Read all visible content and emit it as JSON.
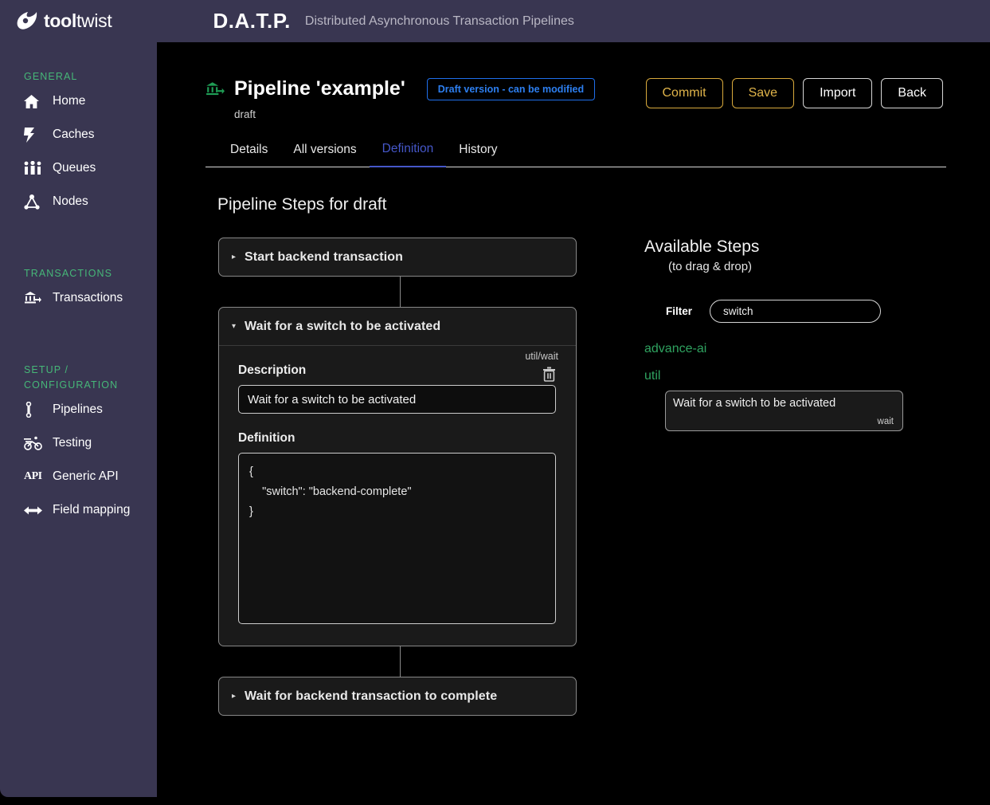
{
  "topbar": {
    "brand_bold": "tool",
    "brand_light": "twist",
    "logo_icon": "flame-logo-icon",
    "product": "D.A.T.P.",
    "product_subtitle": "Distributed Asynchronous Transaction Pipelines"
  },
  "sidebar": {
    "groups": [
      {
        "label": "GENERAL",
        "items": [
          {
            "label": "Home",
            "icon": "home-icon"
          },
          {
            "label": "Caches",
            "icon": "bolt-icon"
          },
          {
            "label": "Queues",
            "icon": "queue-people-icon"
          },
          {
            "label": "Nodes",
            "icon": "nodes-graph-icon"
          }
        ]
      },
      {
        "label": "TRANSACTIONS",
        "items": [
          {
            "label": "Transactions",
            "icon": "bank-transfer-icon"
          }
        ]
      },
      {
        "label": "SETUP / CONFIGURATION",
        "items": [
          {
            "label": "Pipelines",
            "icon": "pipeline-icon"
          },
          {
            "label": "Testing",
            "icon": "cyclist-icon"
          },
          {
            "label": "Generic API",
            "icon": "api-icon"
          },
          {
            "label": "Field mapping",
            "icon": "arrows-left-right-icon"
          }
        ]
      }
    ]
  },
  "header": {
    "icon": "bank-transfer-icon",
    "title": "Pipeline 'example'",
    "badge": "Draft version - can be modified",
    "subtitle": "draft",
    "badge_color": "#2d7ff0",
    "actions": [
      {
        "label": "Commit",
        "style": "amber"
      },
      {
        "label": "Save",
        "style": "amber"
      },
      {
        "label": "Import",
        "style": "plain"
      },
      {
        "label": "Back",
        "style": "plain"
      }
    ]
  },
  "tabs": [
    {
      "label": "Details",
      "active": false
    },
    {
      "label": "All versions",
      "active": false
    },
    {
      "label": "Definition",
      "active": true
    },
    {
      "label": "History",
      "active": false
    }
  ],
  "main": {
    "section_title": "Pipeline Steps for draft",
    "steps": [
      {
        "title": "Start backend transaction",
        "expanded": false,
        "caret": "▸"
      },
      {
        "title": "Wait for a switch to be activated",
        "expanded": true,
        "caret": "▾",
        "type": "util/wait",
        "delete_icon": "trash-icon",
        "description_label": "Description",
        "description_value": "Wait for a switch to be activated",
        "definition_label": "Definition",
        "definition_value": "{\n    \"switch\": \"backend-complete\"\n}"
      },
      {
        "title": "Wait for backend transaction to complete",
        "expanded": false,
        "caret": "▸"
      }
    ]
  },
  "available": {
    "title": "Available Steps",
    "note": "(to drag & drop)",
    "filter_label": "Filter",
    "filter_value": "switch",
    "filter_placeholder": "",
    "categories": [
      {
        "label": "advance-ai",
        "cards": []
      },
      {
        "label": "util",
        "cards": [
          {
            "title": "Wait for a switch to be activated",
            "type": "wait"
          }
        ]
      }
    ]
  }
}
